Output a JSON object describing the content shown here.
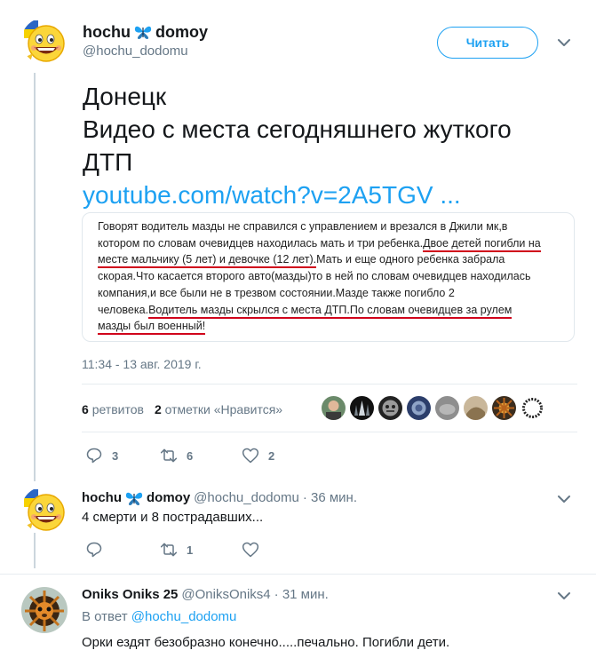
{
  "main_tweet": {
    "author_name_part1": "hochu",
    "author_name_part2": "domoy",
    "author_handle": "@hochu_dodomu",
    "follow_label": "Читать",
    "text_lines": [
      "Донецк",
      "Видео с места сегодняшнего жуткого",
      "ДТП"
    ],
    "link": "youtube.com/watch?v=2A5TGV ...",
    "card_lines": [
      {
        "plain": "Говорят водитель мазды не справился с управлением и врезался в Джили мк,в"
      },
      {
        "plain": "котором по словам очевидцев находилась мать и три ребенка.",
        "underlined": "Двое детей погибли на"
      },
      {
        "underlined": "месте мальчику (5 лет) и девочке (12 лет).",
        "plain": "Мать и еще одного ребенка забрала"
      },
      {
        "plain": "скорая.Что касается второго авто(мазды)то в ней по словам очевидцев находилась"
      },
      {
        "plain": "компания,и все были не в трезвом состоянии.Мазде также погибло 2"
      },
      {
        "plain": "человека.",
        "underlined": "Водитель мазды скрылся с места ДТП.По словам очевидцев за рулем"
      },
      {
        "underlined": "мазды был военный!"
      }
    ],
    "timestamp": "11:34 - 13 авг. 2019 г.",
    "retweets_count": "6",
    "retweets_label": "ретвитов",
    "likes_count": "2",
    "likes_label": "отметки «Нравится»",
    "replies": "3",
    "retweets": "6",
    "likes": "2"
  },
  "reply1": {
    "name_part1": "hochu",
    "name_part2": "domoy",
    "handle": "@hochu_dodomu",
    "time": "· 36 мин.",
    "text": "4 смерти и 8 пострадавших...",
    "replies": "",
    "retweets": "1",
    "likes": ""
  },
  "reply2": {
    "name": "Oniks Oniks 25",
    "handle": "@OniksOniks4",
    "time": "· 31 мин.",
    "reply_to_label": "В ответ",
    "reply_to_mention": "@hochu_dodomu",
    "text": "Орки ездят безобразно конечно.....печально. Погибли дети."
  },
  "colors": {
    "accent": "#1da1f2",
    "muted": "#657786",
    "underline": "#d0021b"
  }
}
